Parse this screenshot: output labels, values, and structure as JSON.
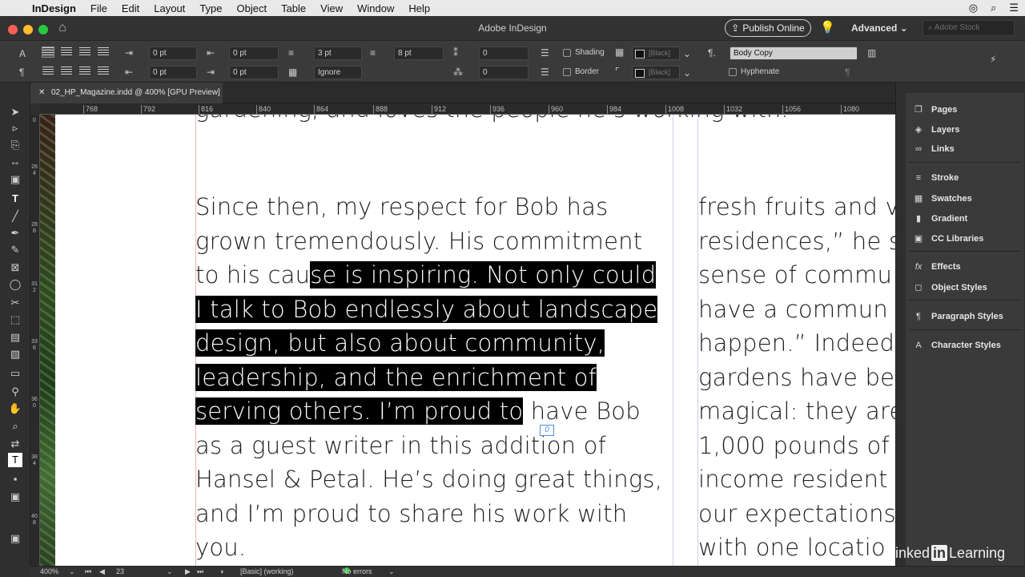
{
  "menubar": {
    "app_name": "InDesign",
    "items": [
      "File",
      "Edit",
      "Layout",
      "Type",
      "Object",
      "Table",
      "View",
      "Window",
      "Help"
    ]
  },
  "titlebar": {
    "title": "Adobe InDesign",
    "publish_label": "Publish Online",
    "workspace": "Advanced",
    "search_placeholder": "Adobe Stock"
  },
  "control_panel": {
    "left_indent": "0 pt",
    "right_indent": "0 pt",
    "first_line_indent": "0 pt",
    "last_line_indent": "0 pt",
    "space_before": "3 pt",
    "space_after": "8 pt",
    "align_to_grid": "Ignore",
    "drop_cap_lines": "0",
    "drop_cap_chars": "0",
    "shading_label": "Shading",
    "border_label": "Border",
    "shading_color": "[Black]",
    "border_color": "[Black]",
    "paragraph_style": "Body Copy",
    "hyphenate_label": "Hyphenate"
  },
  "document": {
    "tab_title": "02_HP_Magazine.indd @ 400% [GPU Preview]",
    "ruler_ticks": [
      "768",
      "792",
      "816",
      "840",
      "864",
      "888",
      "912",
      "936",
      "960",
      "984",
      "1008",
      "1032",
      "1056",
      "1080"
    ],
    "v_ruler": [
      "0",
      "264",
      "288",
      "312",
      "336",
      "360",
      "384",
      "408"
    ],
    "top_line": "gardening, and loves the people he’s working with.",
    "col1": {
      "l1": "Since then, my respect for Bob has",
      "l2": "grown tremendously. His commitment",
      "l3a": "to his cau",
      "l3b": "se is inspiring. Not only could ",
      "l4": "I talk to Bob endlessly about landscape",
      "l5": "design, but also about community,",
      "l6": "leadership, and the enrichment of",
      "l7a": "serving others. I’m proud to",
      "l7b": " have Bob",
      "l8": "as a guest writer in this addition of",
      "l9": "Hansel & Petal. He’s doing great things,",
      "l10": "and I’m proud to share his work with",
      "l11": "you."
    },
    "col2": [
      "fresh fruits and v",
      "residences,” he s",
      "sense of commu",
      "have a commun",
      "happen.” Indeed",
      "gardens have be",
      "magical: they are",
      "1,000 pounds of f",
      "income resident",
      "our expectations",
      "with one locatio"
    ],
    "note_marker": "0"
  },
  "panels": {
    "items": [
      "Pages",
      "Layers",
      "Links",
      "Stroke",
      "Swatches",
      "Gradient",
      "CC Libraries",
      "Effects",
      "Object Styles",
      "Paragraph Styles",
      "Character Styles"
    ]
  },
  "statusbar": {
    "zoom": "400%",
    "page": "23",
    "profile": "[Basic] (working)",
    "preflight": "No errors"
  },
  "watermark": {
    "left": "Linked",
    "badge": "in",
    "right": "Learning"
  }
}
